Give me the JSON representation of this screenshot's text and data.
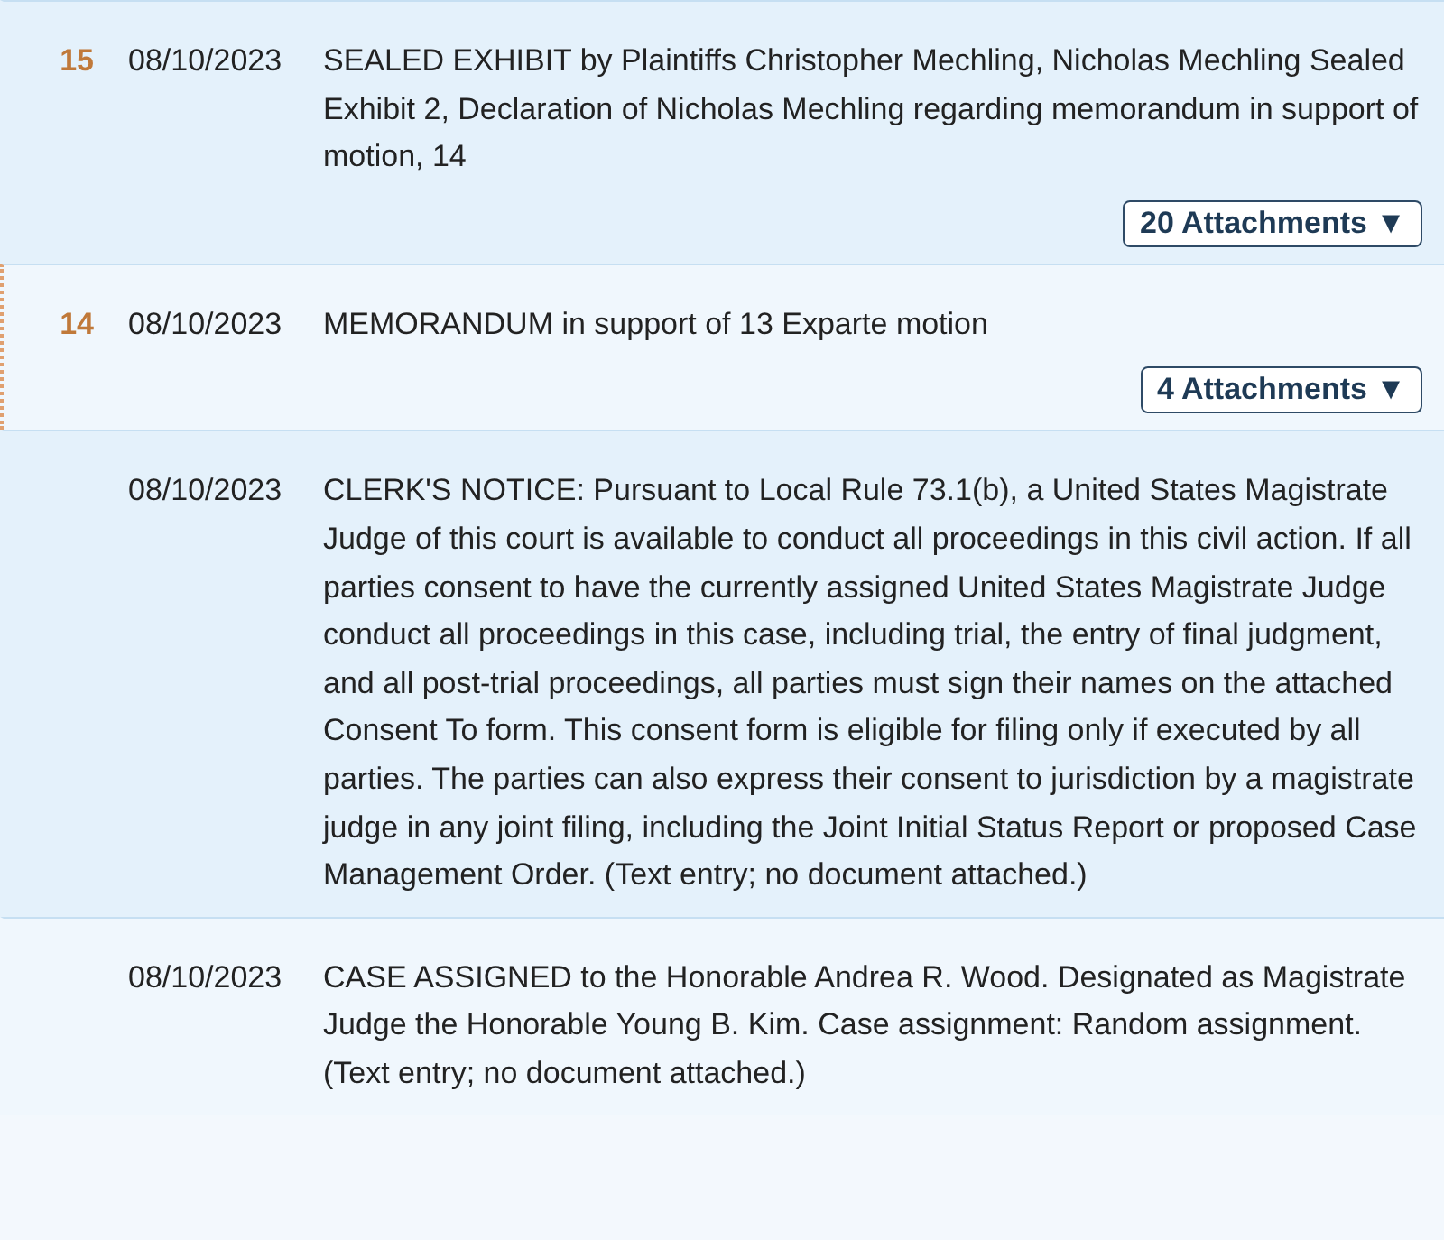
{
  "entries": [
    {
      "number": "15",
      "date": "08/10/2023",
      "text": "SEALED EXHIBIT by Plaintiffs Christopher Mechling, Nicholas Mechling Sealed Exhibit 2, Declaration of Nicholas Mechling regarding memorandum in support of motion, 14",
      "attachments": "20 Attachments ▼",
      "marked": false
    },
    {
      "number": "14",
      "date": "08/10/2023",
      "text": "MEMORANDUM in support of 13 Exparte motion",
      "attachments": "4 Attachments ▼",
      "marked": true
    },
    {
      "date": "08/10/2023",
      "text": "CLERK'S NOTICE: Pursuant to Local Rule 73.1(b), a United States Magistrate Judge of this court is available to conduct all proceedings in this civil action. If all parties consent to have the currently assigned United States Magistrate Judge conduct all proceedings in this case, including trial, the entry of final judgment, and all post-trial proceedings, all parties must sign their names on the attached Consent To form. This consent form is eligible for filing only if executed by all parties. The parties can also express their consent to jurisdiction by a magistrate judge in any joint filing, including the Joint Initial Status Report or proposed Case Management Order. (Text entry; no document attached.)",
      "marked": false
    },
    {
      "date": "08/10/2023",
      "text": "CASE ASSIGNED to the Honorable Andrea R. Wood. Designated as Magistrate Judge the Honorable Young B. Kim. Case assignment: Random assignment. (Text entry; no document attached.)",
      "marked": false
    }
  ]
}
